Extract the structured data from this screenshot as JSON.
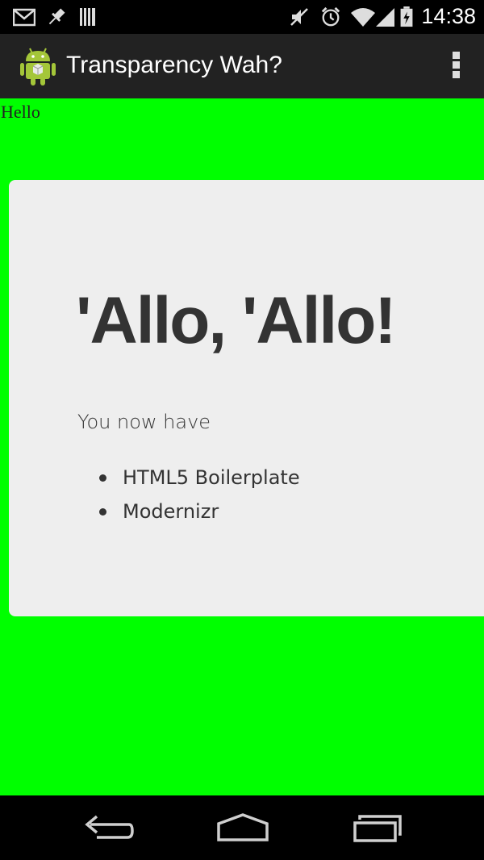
{
  "status_bar": {
    "time": "14:38",
    "icons": [
      "gmail-icon",
      "pin-icon",
      "barcode-icon",
      "mute-icon",
      "alarm-icon",
      "wifi-icon",
      "signal-icon",
      "battery-icon"
    ]
  },
  "action_bar": {
    "title": "Transparency Wah?",
    "icon": "android-app-icon",
    "menu_icon": "overflow-menu-icon"
  },
  "content": {
    "background": "#00ff00",
    "hello_text": "Hello",
    "jumbotron": {
      "heading": "'Allo, 'Allo!",
      "lead": "You now have",
      "items": [
        "HTML5 Boilerplate",
        "Modernizr"
      ]
    }
  },
  "nav_bar": {
    "buttons": [
      "back-icon",
      "home-icon",
      "recent-apps-icon"
    ]
  }
}
